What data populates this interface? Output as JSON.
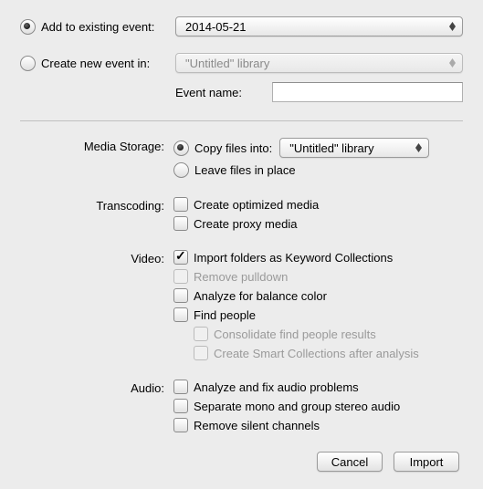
{
  "top": {
    "add_existing_label": "Add to existing event:",
    "add_existing_value": "2014-05-21",
    "create_new_label": "Create new event in:",
    "create_new_value": "\"Untitled\" library",
    "event_name_label": "Event name:"
  },
  "media_storage": {
    "label": "Media Storage:",
    "copy_label": "Copy files into:",
    "copy_value": "\"Untitled\" library",
    "leave_label": "Leave files in place"
  },
  "transcoding": {
    "label": "Transcoding:",
    "optimized": "Create optimized media",
    "proxy": "Create proxy media"
  },
  "video": {
    "label": "Video:",
    "import_folders": "Import folders as Keyword Collections",
    "remove_pulldown": "Remove pulldown",
    "analyze_balance": "Analyze for balance color",
    "find_people": "Find people",
    "consolidate": "Consolidate find people results",
    "smart_collections": "Create Smart Collections after analysis"
  },
  "audio": {
    "label": "Audio:",
    "analyze_fix": "Analyze and fix audio problems",
    "separate_mono": "Separate mono and group stereo audio",
    "remove_silent": "Remove silent channels"
  },
  "buttons": {
    "cancel": "Cancel",
    "import": "Import"
  }
}
